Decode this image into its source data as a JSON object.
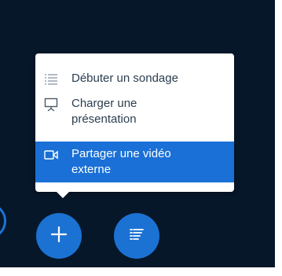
{
  "menu": {
    "items": [
      {
        "label": "Débuter un sondage",
        "icon": "poll-list-icon"
      },
      {
        "label": "Charger une présentation",
        "icon": "presentation-icon"
      },
      {
        "label": "Partager une vidéo externe",
        "icon": "video-icon",
        "selected": true
      }
    ]
  },
  "actions": {
    "primary_icon": "plus-icon",
    "secondary_icon": "list-icon"
  },
  "colors": {
    "background": "#06172a",
    "accent": "#1a70d6",
    "menu_text": "#2b3d4f",
    "menu_background": "#ffffff"
  }
}
